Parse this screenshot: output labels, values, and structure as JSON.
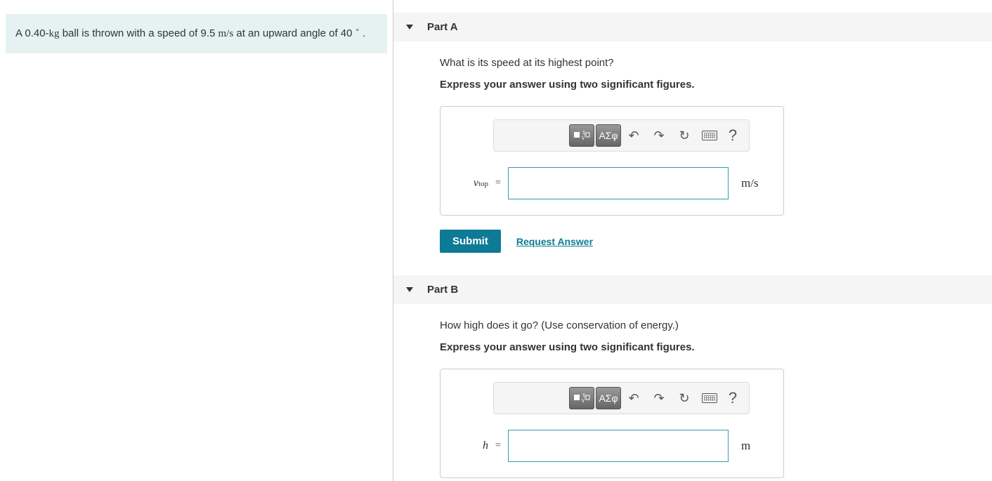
{
  "problem": {
    "text_parts": {
      "p1": "A 0.40-",
      "p2": "kg",
      "p3": " ball is thrown with a speed of 9.5 ",
      "p4": "m/s",
      "p5": " at an upward angle of 40 ",
      "p6": "∘",
      "p7": " ."
    }
  },
  "partA": {
    "title": "Part A",
    "question": "What is its speed at its highest point?",
    "instruction": "Express your answer using two significant figures.",
    "var_label_main": "v",
    "var_label_sub": "top",
    "equals": "=",
    "unit": "m/s",
    "input_value": "",
    "submit": "Submit",
    "request": "Request Answer"
  },
  "partB": {
    "title": "Part B",
    "question": "How high does it go? (Use conservation of energy.)",
    "instruction": "Express your answer using two significant figures.",
    "var_label_main": "h",
    "equals": "=",
    "unit": "m",
    "input_value": ""
  },
  "toolbar": {
    "greek": "ΑΣφ",
    "help": "?"
  }
}
